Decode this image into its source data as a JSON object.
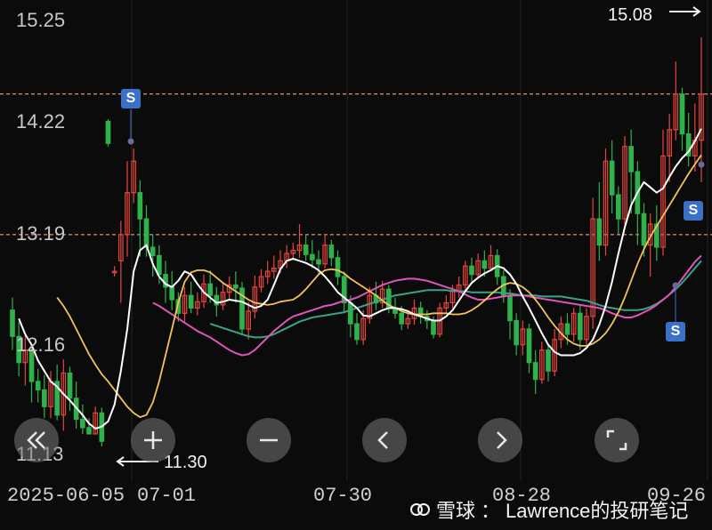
{
  "chart_data": {
    "type": "candlestick",
    "y_ticks": [
      "15.25",
      "14.22",
      "13.19",
      "12.16",
      "11.13"
    ],
    "ylim": [
      11.13,
      15.25
    ],
    "x_ticks": [
      "2025-06-05",
      "07-01",
      "07-30",
      "08-28",
      "09-26"
    ],
    "high_marker": "15.08",
    "low_marker": "11.30",
    "reference_lines": [
      14.54,
      13.2
    ],
    "candles": [
      [
        12.48,
        12.23,
        12.6,
        12.1
      ],
      [
        12.23,
        11.98,
        12.37,
        11.85
      ],
      [
        11.98,
        12.1,
        12.24,
        11.76
      ],
      [
        12.1,
        11.8,
        12.15,
        11.6
      ],
      [
        11.8,
        11.72,
        11.92,
        11.6
      ],
      [
        11.72,
        11.56,
        11.86,
        11.45
      ],
      [
        11.56,
        11.8,
        11.9,
        11.45
      ],
      [
        11.8,
        11.48,
        11.96,
        11.43
      ],
      [
        11.48,
        11.88,
        12.01,
        11.33
      ],
      [
        11.88,
        11.64,
        11.94,
        11.52
      ],
      [
        11.64,
        11.44,
        11.8,
        11.35
      ],
      [
        11.44,
        11.36,
        11.58,
        11.3
      ],
      [
        11.36,
        11.3,
        11.45,
        11.3
      ],
      [
        11.3,
        11.5,
        11.56,
        11.3
      ],
      [
        11.5,
        11.23,
        11.55,
        11.18
      ],
      [
        14.28,
        14.07,
        14.3,
        14.04
      ],
      [
        12.85,
        12.85,
        12.9,
        12.8
      ],
      [
        12.95,
        13.2,
        13.33,
        12.55
      ],
      [
        13.2,
        13.6,
        13.9,
        12.99
      ],
      [
        13.6,
        13.9,
        14.02,
        13.5
      ],
      [
        13.6,
        13.35,
        13.72,
        12.99
      ],
      [
        13.35,
        13.08,
        13.48,
        12.99
      ],
      [
        13.08,
        13.0,
        13.2,
        12.8
      ],
      [
        13.0,
        12.82,
        13.1,
        12.73
      ],
      [
        12.82,
        12.7,
        12.95,
        12.55
      ],
      [
        12.7,
        12.58,
        12.85,
        12.48
      ],
      [
        12.58,
        12.45,
        12.65,
        12.37
      ],
      [
        12.45,
        12.62,
        12.7,
        12.37
      ],
      [
        12.62,
        12.5,
        12.75,
        12.45
      ],
      [
        12.5,
        12.56,
        12.65,
        12.43
      ],
      [
        12.56,
        12.73,
        12.82,
        12.5
      ],
      [
        12.73,
        12.62,
        12.86,
        12.55
      ],
      [
        12.62,
        12.53,
        12.7,
        12.42
      ],
      [
        12.53,
        12.65,
        12.75,
        12.48
      ],
      [
        12.65,
        12.72,
        12.8,
        12.58
      ],
      [
        12.72,
        12.69,
        12.85,
        12.55
      ],
      [
        12.69,
        12.3,
        12.75,
        12.24
      ],
      [
        12.3,
        12.47,
        12.56,
        12.2
      ],
      [
        12.47,
        12.7,
        12.81,
        12.4
      ],
      [
        12.7,
        12.8,
        12.87,
        12.65
      ],
      [
        12.8,
        12.85,
        12.95,
        12.73
      ],
      [
        12.85,
        12.88,
        13.0,
        12.78
      ],
      [
        12.88,
        12.95,
        13.05,
        12.83
      ],
      [
        12.95,
        13.02,
        13.1,
        12.88
      ],
      [
        13.02,
        13.05,
        13.12,
        12.96
      ],
      [
        13.05,
        13.1,
        13.3,
        12.98
      ],
      [
        13.1,
        13.01,
        13.2,
        12.95
      ],
      [
        13.01,
        12.96,
        13.15,
        12.88
      ],
      [
        12.96,
        12.92,
        13.05,
        12.82
      ],
      [
        12.92,
        13.1,
        13.2,
        12.88
      ],
      [
        13.1,
        12.98,
        13.15,
        12.9
      ],
      [
        12.98,
        12.8,
        13.05,
        12.72
      ],
      [
        12.8,
        12.55,
        12.85,
        12.45
      ],
      [
        12.55,
        12.35,
        12.62,
        12.22
      ],
      [
        12.35,
        12.2,
        12.45,
        12.15
      ],
      [
        12.2,
        12.4,
        12.48,
        12.15
      ],
      [
        12.4,
        12.62,
        12.7,
        12.35
      ],
      [
        12.62,
        12.55,
        12.75,
        12.48
      ],
      [
        12.55,
        12.68,
        12.76,
        12.5
      ],
      [
        12.68,
        12.5,
        12.72,
        12.45
      ],
      [
        12.5,
        12.45,
        12.6,
        12.4
      ],
      [
        12.45,
        12.35,
        12.52,
        12.29
      ],
      [
        12.35,
        12.4,
        12.48,
        12.3
      ],
      [
        12.4,
        12.5,
        12.58,
        12.34
      ],
      [
        12.5,
        12.42,
        12.56,
        12.35
      ],
      [
        12.42,
        12.38,
        12.48,
        12.3
      ],
      [
        12.38,
        12.25,
        12.42,
        12.21
      ],
      [
        12.25,
        12.5,
        12.55,
        12.22
      ],
      [
        12.5,
        12.55,
        12.62,
        12.45
      ],
      [
        12.55,
        12.66,
        12.72,
        12.5
      ],
      [
        12.66,
        12.72,
        12.8,
        12.6
      ],
      [
        12.72,
        12.9,
        12.95,
        12.65
      ],
      [
        12.9,
        12.82,
        12.98,
        12.75
      ],
      [
        12.82,
        12.95,
        13.02,
        12.78
      ],
      [
        12.95,
        12.88,
        13.05,
        12.8
      ],
      [
        12.88,
        13.0,
        13.1,
        12.85
      ],
      [
        13.0,
        12.8,
        13.06,
        12.72
      ],
      [
        12.8,
        12.62,
        12.86,
        12.55
      ],
      [
        12.62,
        12.38,
        12.68,
        12.2
      ],
      [
        12.38,
        12.15,
        12.45,
        12.05
      ],
      [
        12.15,
        12.3,
        12.38,
        12.05
      ],
      [
        12.3,
        11.98,
        12.35,
        11.88
      ],
      [
        11.98,
        11.82,
        12.1,
        11.68
      ],
      [
        11.82,
        12.1,
        12.18,
        11.78
      ],
      [
        12.1,
        11.9,
        12.15,
        11.8
      ],
      [
        11.9,
        12.2,
        12.3,
        11.85
      ],
      [
        12.2,
        12.35,
        12.42,
        12.12
      ],
      [
        12.35,
        12.25,
        12.45,
        12.15
      ],
      [
        12.25,
        12.45,
        12.5,
        12.18
      ],
      [
        12.45,
        12.2,
        12.52,
        12.1
      ],
      [
        12.2,
        12.42,
        12.5,
        12.15
      ],
      [
        12.42,
        13.35,
        13.55,
        12.3
      ],
      [
        13.35,
        13.1,
        13.7,
        12.95
      ],
      [
        13.1,
        13.9,
        14.02,
        13.0
      ],
      [
        13.9,
        13.58,
        14.1,
        13.4
      ],
      [
        13.58,
        13.35,
        13.66,
        13.2
      ],
      [
        13.35,
        14.04,
        14.14,
        13.25
      ],
      [
        14.04,
        13.8,
        14.2,
        13.4
      ],
      [
        13.8,
        13.4,
        13.9,
        13.1
      ],
      [
        13.4,
        13.1,
        13.5,
        12.99
      ],
      [
        13.1,
        13.3,
        13.4,
        12.8
      ],
      [
        13.3,
        13.08,
        13.48,
        12.95
      ],
      [
        13.08,
        13.95,
        14.2,
        13.0
      ],
      [
        13.95,
        14.2,
        14.35,
        13.7
      ],
      [
        14.2,
        14.54,
        14.85,
        14.1
      ],
      [
        14.54,
        14.16,
        14.6,
        14.0
      ],
      [
        14.16,
        13.95,
        14.36,
        13.85
      ],
      [
        13.95,
        14.1,
        14.45,
        13.8
      ],
      [
        14.1,
        14.54,
        15.08,
        13.7
      ]
    ],
    "ma_white": [
      12.4,
      12.25,
      12.15,
      12.0,
      11.9,
      11.8,
      11.75,
      11.68,
      11.62,
      11.55,
      11.48,
      11.4,
      11.35,
      11.37,
      11.42,
      11.58,
      11.9,
      12.3,
      12.85,
      13.05,
      13.1,
      12.92,
      12.8,
      12.73,
      12.7,
      12.76,
      12.85,
      12.82,
      12.73,
      12.65,
      12.6,
      12.55,
      12.56,
      12.58,
      12.57,
      12.56,
      12.53,
      12.5,
      12.52,
      12.58,
      12.72,
      12.87,
      12.95,
      12.97,
      12.95,
      12.93,
      12.9,
      12.86,
      12.8,
      12.73,
      12.65,
      12.6,
      12.55,
      12.5,
      12.43,
      12.42,
      12.45,
      12.48,
      12.5,
      12.5,
      12.49,
      12.47,
      12.44,
      12.42,
      12.4,
      12.38,
      12.38,
      12.42,
      12.48,
      12.57,
      12.66,
      12.74,
      12.79,
      12.83,
      12.86,
      12.9,
      12.88,
      12.82,
      12.73,
      12.61,
      12.5,
      12.38,
      12.26,
      12.15,
      12.08,
      12.05,
      12.05,
      12.05,
      12.07,
      12.12,
      12.2,
      12.34,
      12.52,
      12.75,
      13.02,
      13.27,
      13.48,
      13.6,
      13.7,
      13.65,
      13.6,
      13.64,
      13.75,
      13.85,
      13.93,
      13.99,
      14.09,
      14.21
    ],
    "ma_yellow": [
      12.6,
      12.52,
      12.42,
      12.3,
      12.18,
      12.06,
      11.96,
      11.87,
      11.8,
      11.72,
      11.64,
      11.56,
      11.5,
      11.46,
      11.48,
      11.6,
      11.8,
      12.05,
      12.3,
      12.55,
      12.75,
      12.84,
      12.86,
      12.86,
      12.84,
      12.79,
      12.74,
      12.7,
      12.66,
      12.62,
      12.58,
      12.55,
      12.54,
      12.53,
      12.54,
      12.56,
      12.57,
      12.58,
      12.62,
      12.68,
      12.75,
      12.82,
      12.86,
      12.87,
      12.86,
      12.83,
      12.78,
      12.74,
      12.7,
      12.66,
      12.62,
      12.57,
      12.53,
      12.5,
      12.47,
      12.45,
      12.44,
      12.44,
      12.44,
      12.45,
      12.45,
      12.45,
      12.44,
      12.44,
      12.45,
      12.48,
      12.52,
      12.57,
      12.63,
      12.68,
      12.72,
      12.74,
      12.73,
      12.7,
      12.65,
      12.58,
      12.5,
      12.41,
      12.33,
      12.26,
      12.2,
      12.16,
      12.14,
      12.14,
      12.16,
      12.2,
      12.26,
      12.35,
      12.46,
      12.6,
      12.76,
      12.92,
      13.06,
      13.18,
      13.28,
      13.38,
      13.48,
      13.58,
      13.68,
      13.78,
      13.87,
      13.96
    ],
    "ma_pink": [
      12.55,
      12.52,
      12.48,
      12.44,
      12.4,
      12.36,
      12.32,
      12.28,
      12.25,
      12.22,
      12.18,
      12.14,
      12.1,
      12.07,
      12.05,
      12.06,
      12.1,
      12.16,
      12.22,
      12.28,
      12.33,
      12.38,
      12.42,
      12.44,
      12.46,
      12.48,
      12.5,
      12.52,
      12.53,
      12.55,
      12.57,
      12.58,
      12.6,
      12.63,
      12.66,
      12.69,
      12.72,
      12.74,
      12.76,
      12.77,
      12.78,
      12.78,
      12.77,
      12.76,
      12.74,
      12.72,
      12.7,
      12.68,
      12.66,
      12.63,
      12.6,
      12.58,
      12.58,
      12.59,
      12.6,
      12.61,
      12.62,
      12.62,
      12.62,
      12.61,
      12.6,
      12.59,
      12.58,
      12.57,
      12.56,
      12.55,
      12.54,
      12.53,
      12.52,
      12.51,
      12.5,
      12.48,
      12.45,
      12.43,
      12.41,
      12.41,
      12.43,
      12.46,
      12.49,
      12.53,
      12.58,
      12.63,
      12.7,
      12.78,
      12.86,
      12.94,
      13.0
    ],
    "ma_green": [
      12.35,
      12.33,
      12.31,
      12.29,
      12.27,
      12.25,
      12.23,
      12.22,
      12.22,
      12.23,
      12.25,
      12.28,
      12.31,
      12.34,
      12.37,
      12.39,
      12.41,
      12.42,
      12.43,
      12.44,
      12.45,
      12.46,
      12.48,
      12.5,
      12.52,
      12.54,
      12.56,
      12.58,
      12.6,
      12.62,
      12.63,
      12.64,
      12.65,
      12.66,
      12.67,
      12.67,
      12.67,
      12.67,
      12.66,
      12.66,
      12.66,
      12.65,
      12.65,
      12.65,
      12.65,
      12.65,
      12.64,
      12.64,
      12.63,
      12.62,
      12.62,
      12.62,
      12.61,
      12.61,
      12.61,
      12.61,
      12.6,
      12.59,
      12.58,
      12.57,
      12.55,
      12.53,
      12.51,
      12.5,
      12.49,
      12.48,
      12.48,
      12.48,
      12.49,
      12.51,
      12.54,
      12.58,
      12.63,
      12.68,
      12.74,
      12.81,
      12.88,
      12.95
    ]
  },
  "controls": [
    {
      "name": "scroll-left-fast-icon",
      "glyph": "«"
    },
    {
      "name": "zoom-in-icon",
      "glyph": "+"
    },
    {
      "name": "zoom-out-icon",
      "glyph": "−"
    },
    {
      "name": "chevron-left-icon",
      "glyph": "‹"
    },
    {
      "name": "chevron-right-icon",
      "glyph": "›"
    },
    {
      "name": "fullscreen-icon",
      "glyph": "⛶"
    }
  ],
  "sell_marks": [
    "S",
    "S",
    "S"
  ],
  "watermark": {
    "brand": "雪球",
    "sep": "：",
    "author": "Lawrence的投研笔记"
  },
  "colors": {
    "up": "#e8453c",
    "down": "#2fb24a",
    "white": "#ffffff",
    "yellow": "#f3c25a",
    "pink": "#e055b9",
    "green": "#3aa487",
    "ref": "#ffb98f"
  }
}
